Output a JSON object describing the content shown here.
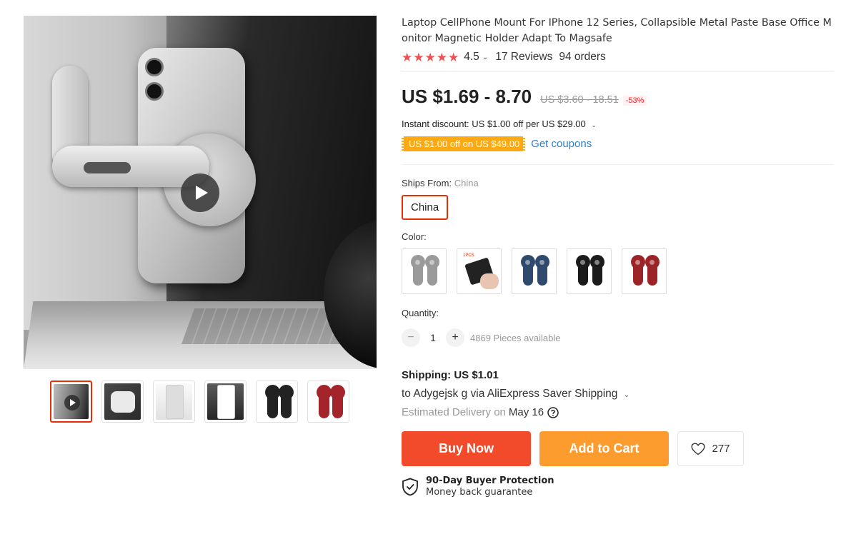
{
  "product": {
    "title": "Laptop CellPhone Mount For IPhone 12 Series, Collapsible Metal Paste Base Office Monitor Magnetic Holder Adapt To Magsafe",
    "rating": "4.5",
    "rating_chevron": "⌄",
    "reviews": "17 Reviews",
    "orders": "94 orders",
    "stars": 4.5
  },
  "gallery": {
    "thumbnail_count": 6,
    "active_index": 0
  },
  "price": {
    "current": "US $1.69 - 8.70",
    "original": "US $3.60 - 18.51",
    "discount": "-53%"
  },
  "promo": {
    "instant_discount": "Instant discount: US $1.00 off per US $29.00",
    "coupon": "US $1.00 off on US $49.00",
    "get_coupons": "Get coupons"
  },
  "ships_from": {
    "label": "Ships From:",
    "value": "China",
    "option": "China"
  },
  "color": {
    "label": "Color:",
    "swatch_tag": "1PCS",
    "swatches": [
      "gray",
      "pad",
      "blue",
      "black",
      "red"
    ]
  },
  "quantity": {
    "label": "Quantity:",
    "value": "1",
    "minus": "−",
    "plus": "+",
    "available": "4869 Pieces available"
  },
  "shipping": {
    "title": "Shipping: US $1.01",
    "to": "to Adygejsk g via AliExpress Saver Shipping",
    "estimated_label": "Estimated Delivery on",
    "date": "May 16"
  },
  "actions": {
    "buy_now": "Buy Now",
    "add_to_cart": "Add to Cart",
    "wishlist_count": "277"
  },
  "protection": {
    "title": "90-Day Buyer Protection",
    "subtitle": "Money back guarantee"
  },
  "colors": {
    "accent": "#e62e04",
    "star": "#f25050",
    "buy": "#f14b2b",
    "cart": "#fc9c2e",
    "coupon": "#fda913",
    "link": "#2e7fcf"
  }
}
